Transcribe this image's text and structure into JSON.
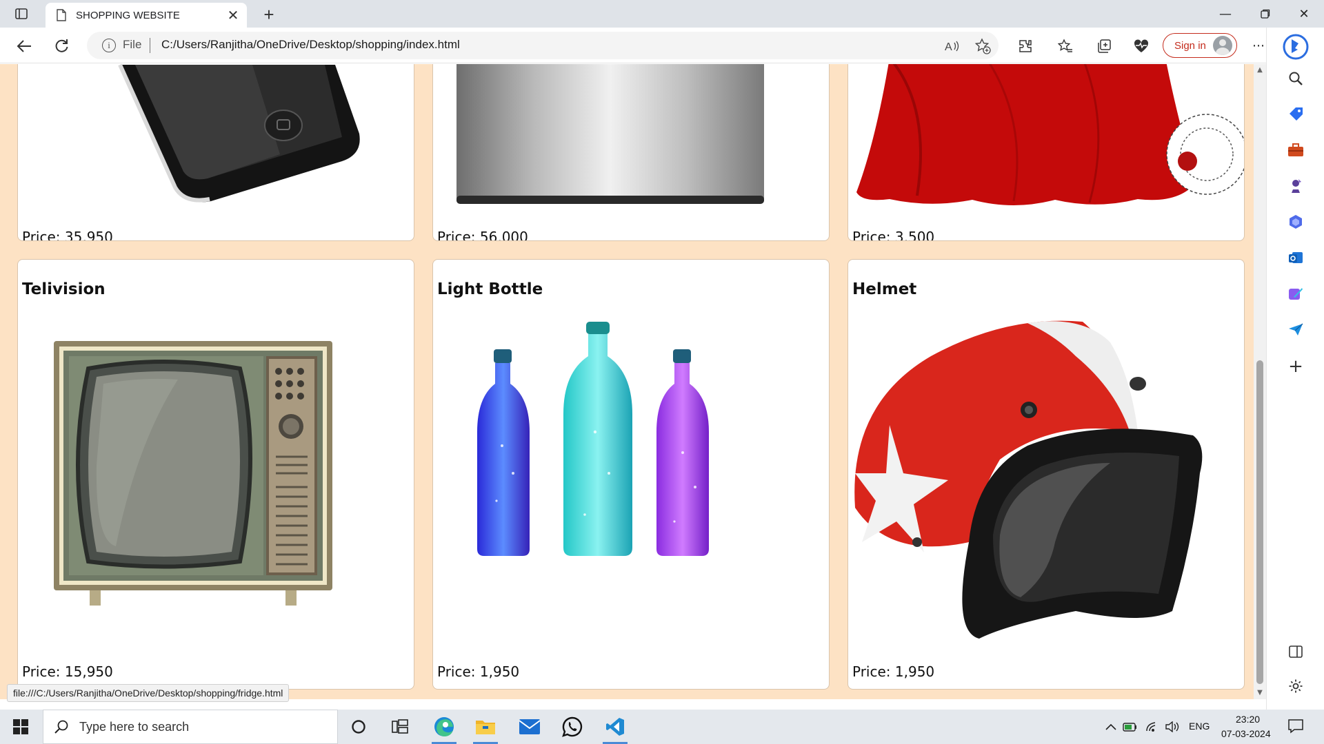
{
  "browser": {
    "tab_title": "SHOPPING WEBSITE",
    "address_scheme": "File",
    "address_url": "C:/Users/Ranjitha/OneDrive/Desktop/shopping/index.html",
    "signin_label": "Sign in",
    "status_url": "file:///C:/Users/Ranjitha/OneDrive/Desktop/shopping/fridge.html"
  },
  "products_top": [
    {
      "price": "Price: 35,950",
      "art": "phone"
    },
    {
      "price": "Price: 56,000",
      "art": "fridge"
    },
    {
      "price": "Price: 3,500",
      "art": "dress"
    }
  ],
  "products": [
    {
      "name": "Telivision",
      "price": "Price: 15,950",
      "art": "tv"
    },
    {
      "name": "Light Bottle",
      "price": "Price: 1,950",
      "art": "bottles"
    },
    {
      "name": "Helmet",
      "price": "Price: 1,950",
      "art": "helmet"
    }
  ],
  "taskbar": {
    "search_placeholder": "Type here to search",
    "language": "ENG",
    "time": "23:20",
    "date": "07-03-2024"
  },
  "icons": {
    "sidebar": [
      "bing-copilot-icon",
      "search-icon",
      "shopping-tag-icon",
      "tools-icon",
      "games-icon",
      "microsoft-365-icon",
      "outlook-icon",
      "designer-icon",
      "send-icon",
      "add-icon",
      "split-screen-icon",
      "settings-icon"
    ],
    "taskbar_apps": [
      "cortana-icon",
      "task-view-icon",
      "edge-icon",
      "file-explorer-icon",
      "mail-icon",
      "whatsapp-icon",
      "vscode-icon"
    ]
  }
}
